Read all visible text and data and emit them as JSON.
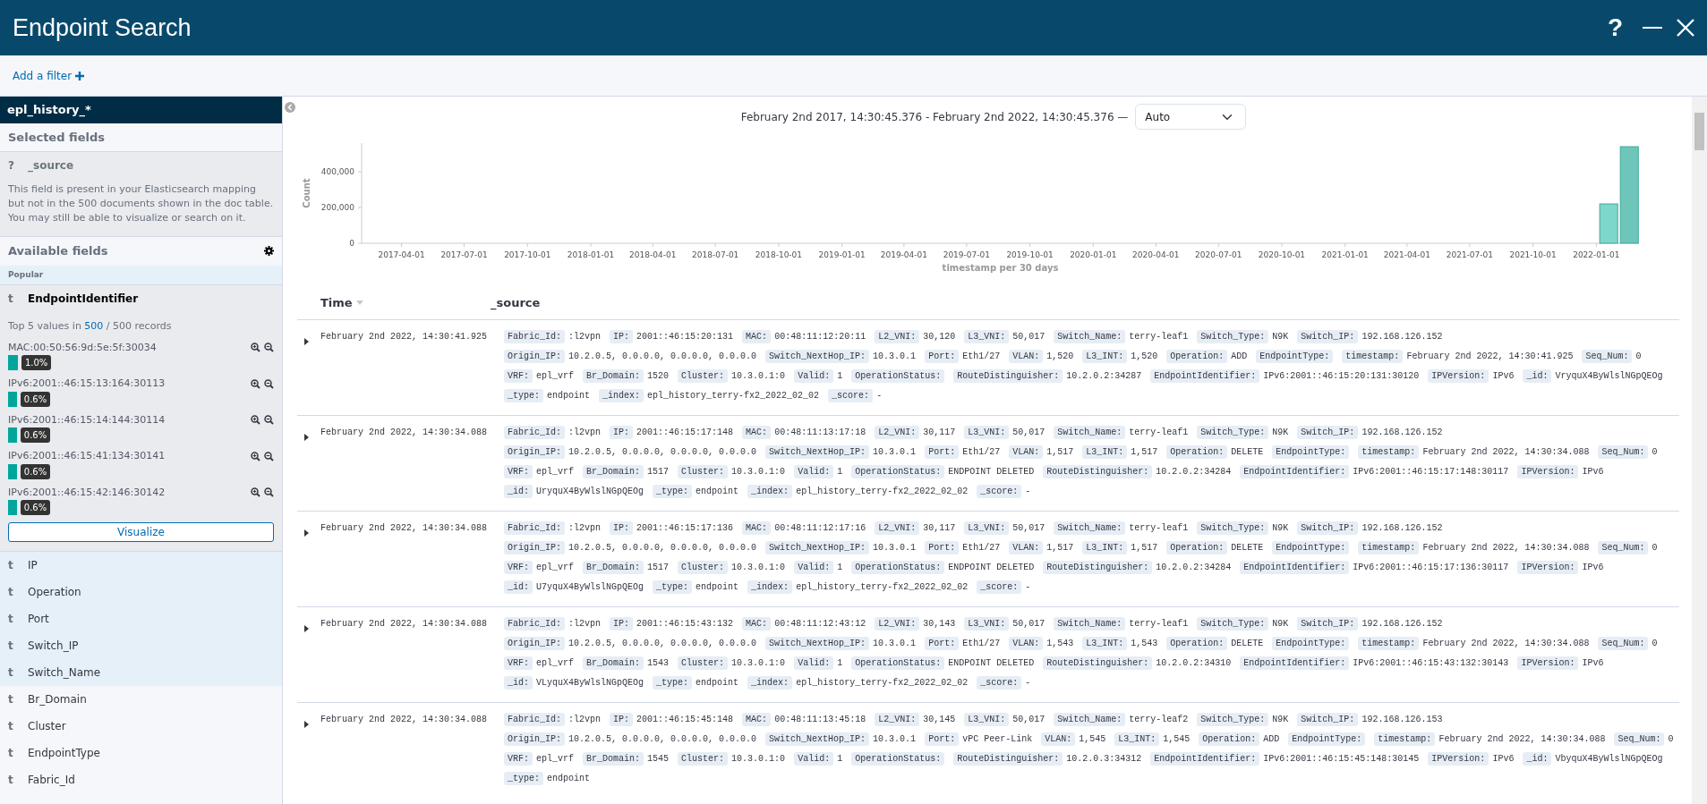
{
  "window": {
    "title": "Endpoint Search",
    "help": "?"
  },
  "filter_bar": {
    "add_filter": "Add a filter"
  },
  "sidebar": {
    "index_pattern": "epl_history_*",
    "selected_heading": "Selected fields",
    "selected_fields": [
      {
        "type": "?",
        "name": "_source",
        "note": "This field is present in your Elasticsearch mapping but not in the 500 documents shown in the doc table. You may still be able to visualize or search on it."
      }
    ],
    "available_heading": "Available fields",
    "popular_label": "Popular",
    "popular_fields": [
      {
        "type": "t",
        "name": "EndpointIdentifier",
        "expanded": true,
        "details": {
          "prefix": "Top 5 values in",
          "link": "500",
          "suffix": "/ 500 records",
          "values": [
            {
              "value": "MAC:00:50:56:9d:5e:5f:30034",
              "percent": "1.0%",
              "level": 0.01
            },
            {
              "value": "IPv6:2001::46:15:13:164:30113",
              "percent": "0.6%",
              "level": 0.006
            },
            {
              "value": "IPv6:2001::46:15:14:144:30114",
              "percent": "0.6%",
              "level": 0.006
            },
            {
              "value": "IPv6:2001::46:15:41:134:30141",
              "percent": "0.6%",
              "level": 0.006
            },
            {
              "value": "IPv6:2001::46:15:42:146:30142",
              "percent": "0.6%",
              "level": 0.006
            }
          ],
          "button": "Visualize"
        }
      },
      {
        "type": "t",
        "name": "IP",
        "expanded": false
      },
      {
        "type": "t",
        "name": "Operation",
        "expanded": false
      },
      {
        "type": "t",
        "name": "Port",
        "expanded": false
      },
      {
        "type": "t",
        "name": "Switch_IP",
        "expanded": false
      },
      {
        "type": "t",
        "name": "Switch_Name",
        "expanded": false
      }
    ],
    "other_fields": [
      {
        "type": "t",
        "name": "Br_Domain"
      },
      {
        "type": "t",
        "name": "Cluster"
      },
      {
        "type": "t",
        "name": "EndpointType"
      },
      {
        "type": "t",
        "name": "Fabric_Id"
      }
    ]
  },
  "histogram": {
    "time_range": "February 2nd 2017, 14:30:45.376 - February 2nd 2022, 14:30:45.376 —",
    "interval": "Auto",
    "chart_data": {
      "type": "bar",
      "xlabel": "timestamp per 30 days",
      "ylabel": "Count",
      "x": [
        "2022-01-19",
        "2022-02-18"
      ],
      "values": [
        220000,
        540000
      ],
      "xlim": [
        "2017-02-02",
        "2022-03-04"
      ],
      "ylim": [
        0,
        560000
      ],
      "xticks": [
        {
          "value": "2017-04-01",
          "label": "2017-04-01"
        },
        {
          "value": "2017-07-01",
          "label": "2017-07-01"
        },
        {
          "value": "2017-10-01",
          "label": "2017-10-01"
        },
        {
          "value": "2018-01-01",
          "label": "2018-01-01"
        },
        {
          "value": "2018-04-01",
          "label": "2018-04-01"
        },
        {
          "value": "2018-07-01",
          "label": "2018-07-01"
        },
        {
          "value": "2018-10-01",
          "label": "2018-10-01"
        },
        {
          "value": "2019-01-01",
          "label": "2019-01-01"
        },
        {
          "value": "2019-04-01",
          "label": "2019-04-01"
        },
        {
          "value": "2019-07-01",
          "label": "2019-07-01"
        },
        {
          "value": "2019-10-01",
          "label": "2019-10-01"
        },
        {
          "value": "2020-01-01",
          "label": "2020-01-01"
        },
        {
          "value": "2020-04-01",
          "label": "2020-04-01"
        },
        {
          "value": "2020-07-01",
          "label": "2020-07-01"
        },
        {
          "value": "2020-10-01",
          "label": "2020-10-01"
        },
        {
          "value": "2021-01-01",
          "label": "2021-01-01"
        },
        {
          "value": "2021-04-01",
          "label": "2021-04-01"
        },
        {
          "value": "2021-07-01",
          "label": "2021-07-01"
        },
        {
          "value": "2021-10-01",
          "label": "2021-10-01"
        },
        {
          "value": "2022-01-01",
          "label": "2022-01-01"
        }
      ],
      "yticks": [
        {
          "value": 0,
          "label": "0"
        },
        {
          "value": 200000,
          "label": "200,000"
        },
        {
          "value": 400000,
          "label": "400,000"
        }
      ]
    }
  },
  "table": {
    "columns": [
      "Time",
      "_source"
    ],
    "rows": [
      {
        "time": "February 2nd 2022, 14:30:41.925",
        "source": [
          {
            "key": "Fabric_Id:",
            "value": ":l2vpn"
          },
          {
            "key": "IP:",
            "value": "2001::46:15:20:131"
          },
          {
            "key": "MAC:",
            "value": "00:48:11:12:20:11"
          },
          {
            "key": "L2_VNI:",
            "value": "30,120"
          },
          {
            "key": "L3_VNI:",
            "value": "50,017"
          },
          {
            "key": "Switch_Name:",
            "value": "terry-leaf1"
          },
          {
            "key": "Switch_Type:",
            "value": "N9K"
          },
          {
            "key": "Switch_IP:",
            "value": "192.168.126.152"
          },
          {
            "key": "Origin_IP:",
            "value": "10.2.0.5, 0.0.0.0, 0.0.0.0, 0.0.0.0"
          },
          {
            "key": "Switch_NextHop_IP:",
            "value": "10.3.0.1"
          },
          {
            "key": "Port:",
            "value": "Eth1/27"
          },
          {
            "key": "VLAN:",
            "value": "1,520"
          },
          {
            "key": "L3_INT:",
            "value": "1,520"
          },
          {
            "key": "Operation:",
            "value": "ADD"
          },
          {
            "key": "EndpointType:"
          },
          {
            "key": "timestamp:",
            "value": "February 2nd 2022, 14:30:41.925"
          },
          {
            "key": "Seq_Num:",
            "value": "0"
          },
          {
            "key": "VRF:",
            "value": "epl_vrf"
          },
          {
            "key": "Br_Domain:",
            "value": "1520"
          },
          {
            "key": "Cluster:",
            "value": "10.3.0.1:0"
          },
          {
            "key": "Valid:",
            "value": "1"
          },
          {
            "key": "OperationStatus:"
          },
          {
            "key": "RouteDistinguisher:",
            "value": "10.2.0.2:34287"
          },
          {
            "key": "EndpointIdentifier:",
            "value": "IPv6:2001::46:15:20:131:30120"
          },
          {
            "key": "IPVersion:",
            "value": "IPv6"
          },
          {
            "key": "_id:",
            "value": "VryquX4ByWlslNGpQEOg"
          },
          {
            "key": "_type:",
            "value": "endpoint"
          },
          {
            "key": "_index:",
            "value": "epl_history_terry-fx2_2022_02_02"
          },
          {
            "key": "_score:",
            "value": "-"
          }
        ]
      },
      {
        "time": "February 2nd 2022, 14:30:34.088",
        "source": [
          {
            "key": "Fabric_Id:",
            "value": ":l2vpn"
          },
          {
            "key": "IP:",
            "value": "2001::46:15:17:148"
          },
          {
            "key": "MAC:",
            "value": "00:48:11:13:17:18"
          },
          {
            "key": "L2_VNI:",
            "value": "30,117"
          },
          {
            "key": "L3_VNI:",
            "value": "50,017"
          },
          {
            "key": "Switch_Name:",
            "value": "terry-leaf1"
          },
          {
            "key": "Switch_Type:",
            "value": "N9K"
          },
          {
            "key": "Switch_IP:",
            "value": "192.168.126.152"
          },
          {
            "key": "Origin_IP:",
            "value": "10.2.0.5, 0.0.0.0, 0.0.0.0, 0.0.0.0"
          },
          {
            "key": "Switch_NextHop_IP:",
            "value": "10.3.0.1"
          },
          {
            "key": "Port:",
            "value": "Eth1/27"
          },
          {
            "key": "VLAN:",
            "value": "1,517"
          },
          {
            "key": "L3_INT:",
            "value": "1,517"
          },
          {
            "key": "Operation:",
            "value": "DELETE"
          },
          {
            "key": "EndpointType:"
          },
          {
            "key": "timestamp:",
            "value": "February 2nd 2022, 14:30:34.088"
          },
          {
            "key": "Seq_Num:",
            "value": "0"
          },
          {
            "key": "VRF:",
            "value": "epl_vrf"
          },
          {
            "key": "Br_Domain:",
            "value": "1517"
          },
          {
            "key": "Cluster:",
            "value": "10.3.0.1:0"
          },
          {
            "key": "Valid:",
            "value": "1"
          },
          {
            "key": "OperationStatus:",
            "value": "ENDPOINT DELETED"
          },
          {
            "key": "RouteDistinguisher:",
            "value": "10.2.0.2:34284"
          },
          {
            "key": "EndpointIdentifier:",
            "value": "IPv6:2001::46:15:17:148:30117"
          },
          {
            "key": "IPVersion:",
            "value": "IPv6"
          },
          {
            "key": "_id:",
            "value": "UryquX4ByWlslNGpQEOg"
          },
          {
            "key": "_type:",
            "value": "endpoint"
          },
          {
            "key": "_index:",
            "value": "epl_history_terry-fx2_2022_02_02"
          },
          {
            "key": "_score:",
            "value": "-"
          }
        ]
      },
      {
        "time": "February 2nd 2022, 14:30:34.088",
        "source": [
          {
            "key": "Fabric_Id:",
            "value": ":l2vpn"
          },
          {
            "key": "IP:",
            "value": "2001::46:15:17:136"
          },
          {
            "key": "MAC:",
            "value": "00:48:11:12:17:16"
          },
          {
            "key": "L2_VNI:",
            "value": "30,117"
          },
          {
            "key": "L3_VNI:",
            "value": "50,017"
          },
          {
            "key": "Switch_Name:",
            "value": "terry-leaf1"
          },
          {
            "key": "Switch_Type:",
            "value": "N9K"
          },
          {
            "key": "Switch_IP:",
            "value": "192.168.126.152"
          },
          {
            "key": "Origin_IP:",
            "value": "10.2.0.5, 0.0.0.0, 0.0.0.0, 0.0.0.0"
          },
          {
            "key": "Switch_NextHop_IP:",
            "value": "10.3.0.1"
          },
          {
            "key": "Port:",
            "value": "Eth1/27"
          },
          {
            "key": "VLAN:",
            "value": "1,517"
          },
          {
            "key": "L3_INT:",
            "value": "1,517"
          },
          {
            "key": "Operation:",
            "value": "DELETE"
          },
          {
            "key": "EndpointType:"
          },
          {
            "key": "timestamp:",
            "value": "February 2nd 2022, 14:30:34.088"
          },
          {
            "key": "Seq_Num:",
            "value": "0"
          },
          {
            "key": "VRF:",
            "value": "epl_vrf"
          },
          {
            "key": "Br_Domain:",
            "value": "1517"
          },
          {
            "key": "Cluster:",
            "value": "10.3.0.1:0"
          },
          {
            "key": "Valid:",
            "value": "1"
          },
          {
            "key": "OperationStatus:",
            "value": "ENDPOINT DELETED"
          },
          {
            "key": "RouteDistinguisher:",
            "value": "10.2.0.2:34284"
          },
          {
            "key": "EndpointIdentifier:",
            "value": "IPv6:2001::46:15:17:136:30117"
          },
          {
            "key": "IPVersion:",
            "value": "IPv6"
          },
          {
            "key": "_id:",
            "value": "U7yquX4ByWlslNGpQEOg"
          },
          {
            "key": "_type:",
            "value": "endpoint"
          },
          {
            "key": "_index:",
            "value": "epl_history_terry-fx2_2022_02_02"
          },
          {
            "key": "_score:",
            "value": "-"
          }
        ]
      },
      {
        "time": "February 2nd 2022, 14:30:34.088",
        "source": [
          {
            "key": "Fabric_Id:",
            "value": ":l2vpn"
          },
          {
            "key": "IP:",
            "value": "2001::46:15:43:132"
          },
          {
            "key": "MAC:",
            "value": "00:48:11:12:43:12"
          },
          {
            "key": "L2_VNI:",
            "value": "30,143"
          },
          {
            "key": "L3_VNI:",
            "value": "50,017"
          },
          {
            "key": "Switch_Name:",
            "value": "terry-leaf1"
          },
          {
            "key": "Switch_Type:",
            "value": "N9K"
          },
          {
            "key": "Switch_IP:",
            "value": "192.168.126.152"
          },
          {
            "key": "Origin_IP:",
            "value": "10.2.0.5, 0.0.0.0, 0.0.0.0, 0.0.0.0"
          },
          {
            "key": "Switch_NextHop_IP:",
            "value": "10.3.0.1"
          },
          {
            "key": "Port:",
            "value": "Eth1/27"
          },
          {
            "key": "VLAN:",
            "value": "1,543"
          },
          {
            "key": "L3_INT:",
            "value": "1,543"
          },
          {
            "key": "Operation:",
            "value": "DELETE"
          },
          {
            "key": "EndpointType:"
          },
          {
            "key": "timestamp:",
            "value": "February 2nd 2022, 14:30:34.088"
          },
          {
            "key": "Seq_Num:",
            "value": "0"
          },
          {
            "key": "VRF:",
            "value": "epl_vrf"
          },
          {
            "key": "Br_Domain:",
            "value": "1543"
          },
          {
            "key": "Cluster:",
            "value": "10.3.0.1:0"
          },
          {
            "key": "Valid:",
            "value": "1"
          },
          {
            "key": "OperationStatus:",
            "value": "ENDPOINT DELETED"
          },
          {
            "key": "RouteDistinguisher:",
            "value": "10.2.0.2:34310"
          },
          {
            "key": "EndpointIdentifier:",
            "value": "IPv6:2001::46:15:43:132:30143"
          },
          {
            "key": "IPVersion:",
            "value": "IPv6"
          },
          {
            "key": "_id:",
            "value": "VLyquX4ByWlslNGpQEOg"
          },
          {
            "key": "_type:",
            "value": "endpoint"
          },
          {
            "key": "_index:",
            "value": "epl_history_terry-fx2_2022_02_02"
          },
          {
            "key": "_score:",
            "value": "-"
          }
        ]
      },
      {
        "time": "February 2nd 2022, 14:30:34.088",
        "source": [
          {
            "key": "Fabric_Id:",
            "value": ":l2vpn"
          },
          {
            "key": "IP:",
            "value": "2001::46:15:45:148"
          },
          {
            "key": "MAC:",
            "value": "00:48:11:13:45:18"
          },
          {
            "key": "L2_VNI:",
            "value": "30,145"
          },
          {
            "key": "L3_VNI:",
            "value": "50,017"
          },
          {
            "key": "Switch_Name:",
            "value": "terry-leaf2"
          },
          {
            "key": "Switch_Type:",
            "value": "N9K"
          },
          {
            "key": "Switch_IP:",
            "value": "192.168.126.153"
          },
          {
            "key": "Origin_IP:",
            "value": "10.2.0.5, 0.0.0.0, 0.0.0.0, 0.0.0.0"
          },
          {
            "key": "Switch_NextHop_IP:",
            "value": "10.3.0.1"
          },
          {
            "key": "Port:",
            "value": "vPC Peer-Link"
          },
          {
            "key": "VLAN:",
            "value": "1,545"
          },
          {
            "key": "L3_INT:",
            "value": "1,545"
          },
          {
            "key": "Operation:",
            "value": "ADD"
          },
          {
            "key": "EndpointType:"
          },
          {
            "key": "timestamp:",
            "value": "February 2nd 2022, 14:30:34.088"
          },
          {
            "key": "Seq_Num:",
            "value": "0"
          },
          {
            "key": "VRF:",
            "value": "epl_vrf"
          },
          {
            "key": "Br_Domain:",
            "value": "1545"
          },
          {
            "key": "Cluster:",
            "value": "10.3.0.1:0"
          },
          {
            "key": "Valid:",
            "value": "1"
          },
          {
            "key": "OperationStatus:"
          },
          {
            "key": "RouteDistinguisher:",
            "value": "10.2.0.3:34312"
          },
          {
            "key": "EndpointIdentifier:",
            "value": "IPv6:2001::46:15:45:148:30145"
          },
          {
            "key": "IPVersion:",
            "value": "IPv6"
          },
          {
            "key": "_id:",
            "value": "VbyquX4ByWlslNGpQEOg"
          },
          {
            "key": "_type:",
            "value": "endpoint"
          }
        ]
      }
    ]
  }
}
